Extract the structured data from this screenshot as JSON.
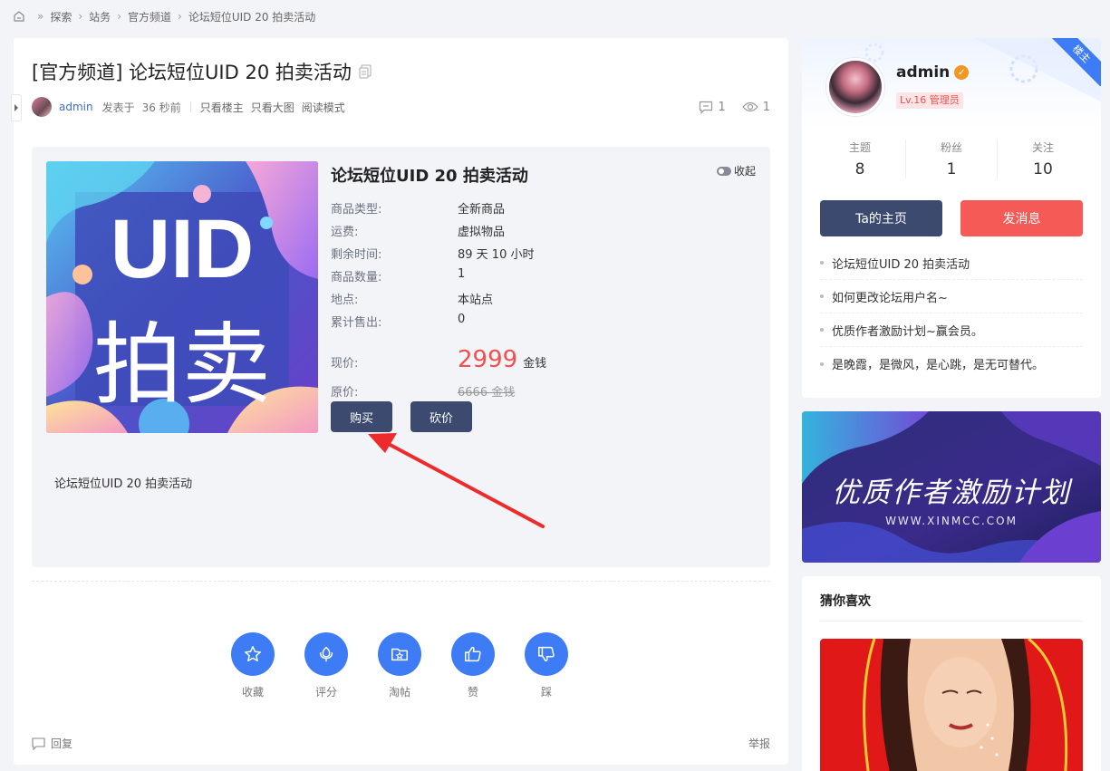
{
  "breadcrumb": {
    "items": [
      "探索",
      "站务",
      "官方频道",
      "论坛短位UID 20 拍卖活动"
    ],
    "sep": "»"
  },
  "post": {
    "title": "[官方频道] 论坛短位UID 20 拍卖活动",
    "author": "admin",
    "posted_prefix": "发表于",
    "posted_time": "36 秒前",
    "links": [
      "只看楼主",
      "只看大图",
      "阅读模式"
    ],
    "comments": "1",
    "views": "1"
  },
  "auction": {
    "poster_text_top": "UID",
    "poster_text_bottom": "拍卖",
    "title": "论坛短位UID 20 拍卖活动",
    "collapse_label": "收起",
    "specs": [
      {
        "k": "商品类型:",
        "v": "全新商品"
      },
      {
        "k": "运费:",
        "v": "虚拟物品"
      },
      {
        "k": "剩余时间:",
        "v": "89 天 10 小时"
      },
      {
        "k": "商品数量:",
        "v": "1"
      },
      {
        "k": "地点:",
        "v": "本站点"
      },
      {
        "k": "累计售出:",
        "v": "0"
      }
    ],
    "price_label": "现价:",
    "price": "2999",
    "price_unit": "金钱",
    "orig_label": "原价:",
    "orig_price": "6666 金钱",
    "buy_label": "购买",
    "bargain_label": "砍价",
    "description": "论坛短位UID 20 拍卖活动"
  },
  "actions": [
    {
      "label": "收藏",
      "icon": "star-icon"
    },
    {
      "label": "评分",
      "icon": "flower-icon"
    },
    {
      "label": "淘帖",
      "icon": "folder-star-icon"
    },
    {
      "label": "赞",
      "icon": "thumbs-up-icon"
    },
    {
      "label": "踩",
      "icon": "thumbs-down-icon"
    }
  ],
  "footer": {
    "reply": "回复",
    "report": "举报"
  },
  "profile": {
    "ribbon": "楼主",
    "name": "admin",
    "level": "Lv.16 管理员",
    "stats": [
      {
        "k": "主题",
        "v": "8"
      },
      {
        "k": "粉丝",
        "v": "1"
      },
      {
        "k": "关注",
        "v": "10"
      }
    ],
    "home_button": "Ta的主页",
    "message_button": "发消息",
    "posts": [
      "论坛短位UID 20 拍卖活动",
      "如何更改论坛用户名~",
      "优质作者激励计划~赢会员。",
      "是晚霞，是微风，是心跳，是无可替代。"
    ],
    "colors": {
      "home": "#3c4a6f",
      "message": "#f55a56"
    }
  },
  "banner": {
    "title": "优质作者激励计划",
    "subtitle": "WWW.XINMCC.COM"
  },
  "guess": {
    "title": "猜你喜欢"
  }
}
